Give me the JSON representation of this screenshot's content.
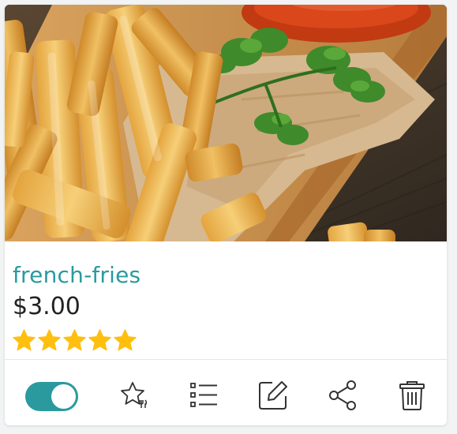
{
  "product": {
    "name": "french-fries",
    "price": "$3.00",
    "rating": 5,
    "rating_max": 5,
    "photo_subject": "french fries on wooden board with parsley and ketchup"
  },
  "status": {
    "enabled": true
  },
  "icons": {
    "toggle": "toggle-switch",
    "rate": "star-dining-icon",
    "list": "list-icon",
    "edit": "edit-icon",
    "share": "share-icon",
    "delete": "trash-icon"
  },
  "colors": {
    "accent": "#2a9a9f",
    "star": "#ffbf0f",
    "price_text": "#222222",
    "icon": "#333333"
  }
}
